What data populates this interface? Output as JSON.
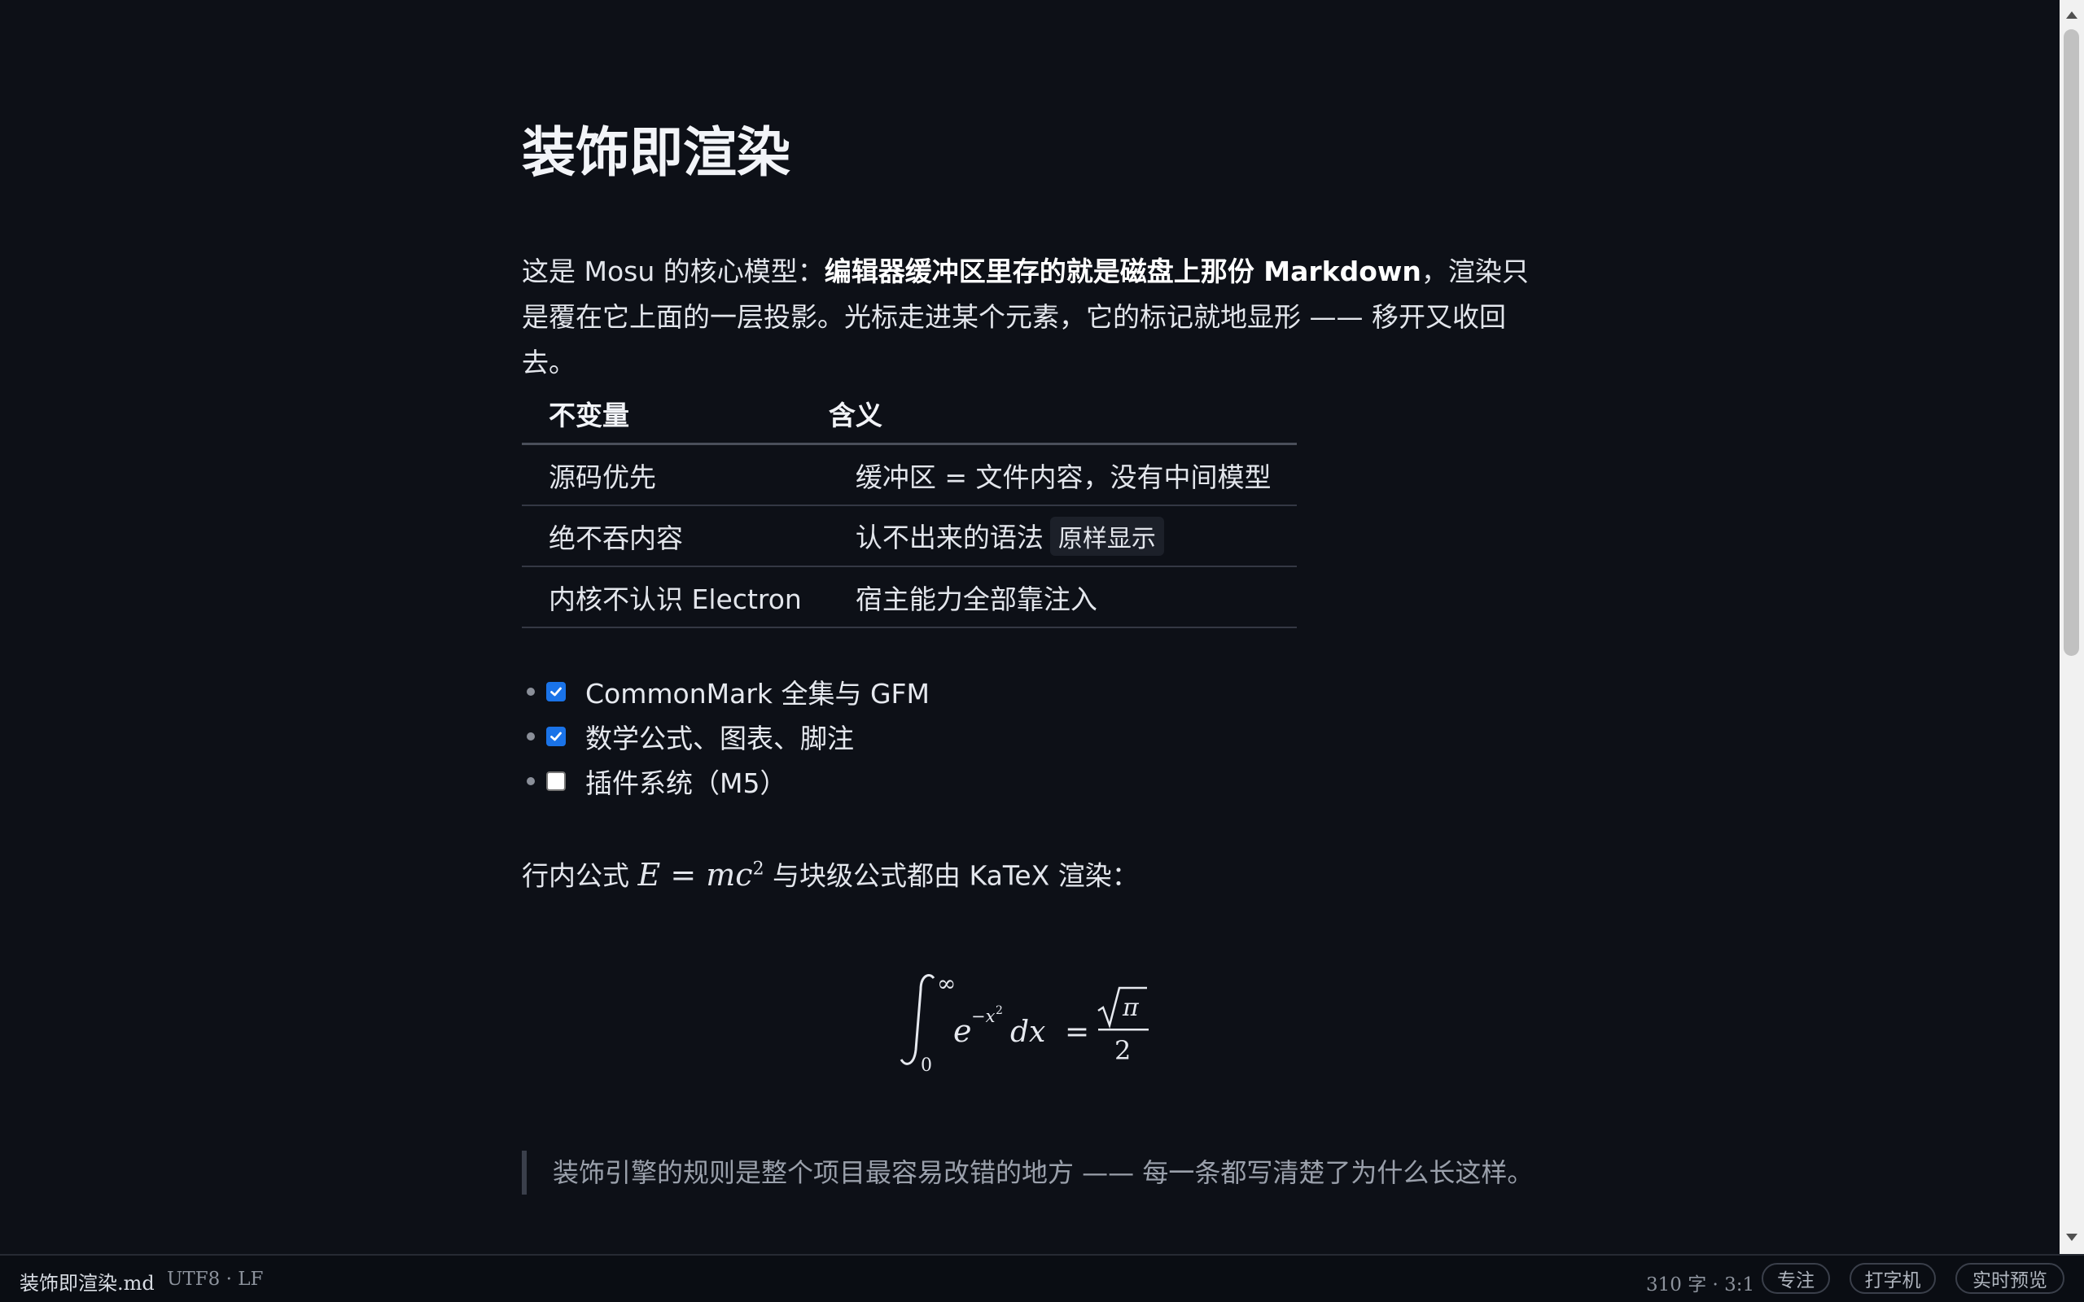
{
  "document": {
    "title": "装饰即渲染",
    "paragraph": {
      "pre": "这是 Mosu 的核心模型：",
      "bold": "编辑器缓冲区里存的就是磁盘上那份 Markdown",
      "post": "，渲染只是覆在它上面的一层投影。光标走进某个元素，它的标记就地显形 —— 移开又收回去。"
    },
    "table": {
      "headers": [
        "不变量",
        "含义"
      ],
      "rows": [
        {
          "invariant": "源码优先",
          "meaning": "缓冲区 = 文件内容，没有中间模型",
          "code": ""
        },
        {
          "invariant": "绝不吞内容",
          "meaning": "认不出来的语法",
          "code": "原样显示"
        },
        {
          "invariant": "内核不认识 Electron",
          "meaning": "宿主能力全部靠注入",
          "code": ""
        }
      ]
    },
    "tasks": [
      {
        "label": "CommonMark 全集与 GFM",
        "checked": true
      },
      {
        "label": "数学公式、图表、脚注",
        "checked": true
      },
      {
        "label": "插件系统（M5）",
        "checked": false
      }
    ],
    "math_line": {
      "pre": "行内公式 ",
      "formula_base": "E = mc",
      "formula_exp": "2",
      "post": " 与块级公式都由 KaTeX 渲染："
    },
    "block_formula": {
      "lower": "0",
      "upper": "∞",
      "base": "e",
      "exponent": "−x",
      "exponent_power": "2",
      "dx": "dx",
      "equals": "=",
      "numerator": "π",
      "denominator": "2"
    },
    "blockquote": "装饰引擎的规则是整个项目最容易改错的地方 —— 每一条都写清楚了为什么长这样。"
  },
  "statusbar": {
    "filename": "装饰即渲染.md",
    "encoding": "UTF8 · LF",
    "stats": "310 字 · 3:1",
    "buttons": {
      "focus": "专注",
      "typewriter": "打字机",
      "live_preview": "实时预览"
    }
  },
  "colors": {
    "background": "#0d1017",
    "checkbox_accent": "#1a73e8",
    "statusbar_bg": "#0a0d13"
  }
}
